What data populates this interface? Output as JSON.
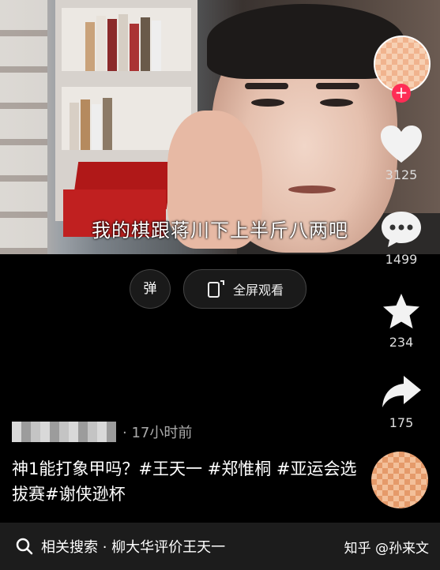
{
  "video": {
    "subtitle": "我的棋跟蒋川下上半斤八两吧"
  },
  "sidebar": {
    "like_count": "3125",
    "comment_count": "1499",
    "favorite_count": "234",
    "share_count": "175",
    "follow_symbol": "+"
  },
  "controls": {
    "danmu_label": "弹",
    "fullscreen_label": "全屏观看"
  },
  "post": {
    "time": "· 17小时前",
    "description": "神1能打象甲吗？#王天一 #郑惟桐 #亚运会选拔赛#谢侠逊杯"
  },
  "search": {
    "related_label": "相关搜索 · 柳大华评价王天一"
  },
  "watermark": "知乎 @孙来文",
  "colors": {
    "follow": "#fe2c55",
    "background": "#000000"
  }
}
